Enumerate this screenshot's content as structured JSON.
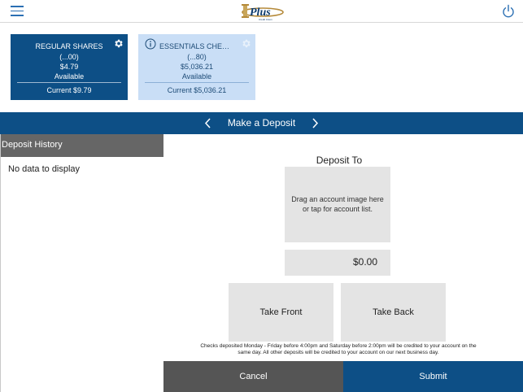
{
  "header": {
    "logo_text": "Plus",
    "logo_subtext": "Credit Union"
  },
  "accounts": [
    {
      "name": "REGULAR SHARES",
      "number": "(...00)",
      "balance": "$4.79",
      "available_label": "Available",
      "current": "Current $9.79"
    },
    {
      "name": "ESSENTIALS CHEC...",
      "number": "(...80)",
      "balance": "$5,036.21",
      "available_label": "Available",
      "current": "Current $5,036.21"
    }
  ],
  "deposit_bar": {
    "title": "Make a Deposit"
  },
  "history": {
    "header": "Deposit History",
    "empty_text": "No data to display"
  },
  "deposit_form": {
    "deposit_to_label": "Deposit To",
    "drop_zone_text": "Drag an account image here or tap for account list.",
    "amount": "$0.00",
    "take_front_label": "Take Front",
    "take_back_label": "Take Back",
    "disclaimer": "Checks deposited Monday - Friday before 4:00pm and Saturday before 2:00pm will be credited to your account on the same day. All other deposits will be credited to your account on our next business day."
  },
  "actions": {
    "cancel_label": "Cancel",
    "submit_label": "Submit"
  },
  "icons": {
    "menu": "menu-icon",
    "power": "power-icon",
    "gear": "gear-icon",
    "info": "info-icon",
    "chevron_left": "chevron-left-icon",
    "chevron_right": "chevron-right-icon"
  },
  "colors": {
    "brand_blue": "#0d4f86",
    "selected_card": "#c9def6",
    "history_header": "#666666",
    "cancel": "#555555",
    "panel_gray": "#e4e4e4"
  }
}
